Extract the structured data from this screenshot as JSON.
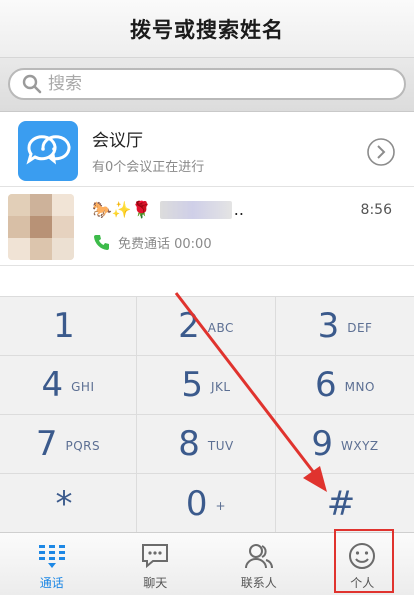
{
  "header": {
    "title": "拨号或搜索姓名"
  },
  "search": {
    "placeholder": "搜索"
  },
  "conference": {
    "title": "会议厅",
    "subtitle": "有0个会议正在进行"
  },
  "recent_call": {
    "name_emoji": "🐎✨🌹",
    "name_suffix": "..",
    "time": "8:56",
    "detail": "免费通话 00:00"
  },
  "keypad": {
    "keys": [
      {
        "digit": "1",
        "letters": ""
      },
      {
        "digit": "2",
        "letters": "ABC"
      },
      {
        "digit": "3",
        "letters": "DEF"
      },
      {
        "digit": "4",
        "letters": "GHI"
      },
      {
        "digit": "5",
        "letters": "JKL"
      },
      {
        "digit": "6",
        "letters": "MNO"
      },
      {
        "digit": "7",
        "letters": "PQRS"
      },
      {
        "digit": "8",
        "letters": "TUV"
      },
      {
        "digit": "9",
        "letters": "WXYZ"
      },
      {
        "digit": "*",
        "letters": ""
      },
      {
        "digit": "0",
        "letters": "+"
      },
      {
        "digit": "#",
        "letters": ""
      }
    ]
  },
  "tabs": [
    {
      "label": "通话",
      "icon": "dialpad-icon",
      "active": true
    },
    {
      "label": "聊天",
      "icon": "chat-bubble-icon",
      "active": false
    },
    {
      "label": "联系人",
      "icon": "contacts-icon",
      "active": false
    },
    {
      "label": "个人",
      "icon": "smiley-icon",
      "active": false
    }
  ],
  "colors": {
    "accent": "#1e88e5",
    "keypad_text": "#3b5a8c",
    "annotation_red": "#e0332e",
    "conference_icon_bg": "#3a9df0",
    "call_green": "#3dbb4a"
  }
}
